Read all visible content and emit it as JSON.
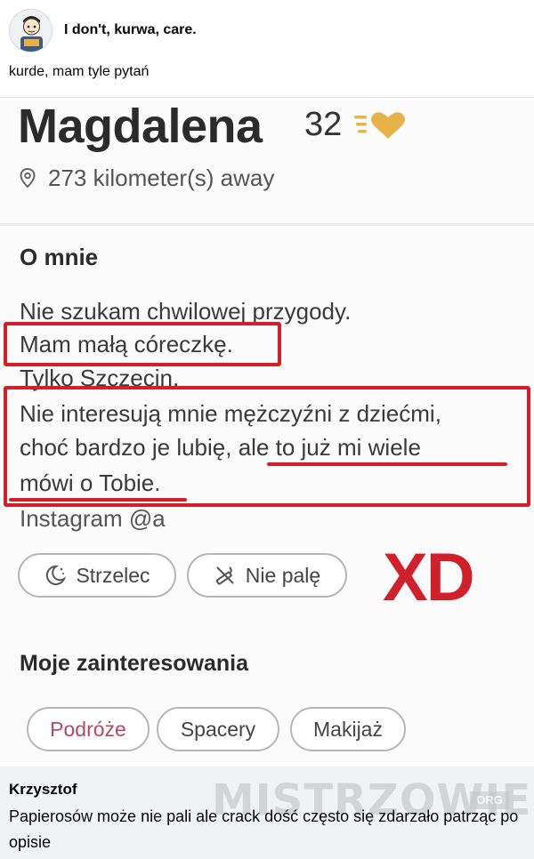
{
  "post": {
    "author": "I don't, kurwa, care.",
    "text": "kurde, mam tyle pytań"
  },
  "profile": {
    "name": "Magdalena",
    "age": "32",
    "distance": "273 kilometer(s) away",
    "about_heading": "O mnie",
    "bio": {
      "line1": "Nie szukam chwilowej przygody.",
      "line2": "Mam małą córeczkę.",
      "line3": "Tylko Szczecin.",
      "line4": "Nie interesują mnie mężczyźni z dziećmi,",
      "line5": "choć bardzo je lubię, ale to już mi wiele",
      "line6": "mówi o Tobie.",
      "line7": "Instagram @a"
    },
    "tags": {
      "sign": "Strzelec",
      "smoking": "Nie palę"
    },
    "overlay_text": "XD",
    "interests_heading": "Moje zainteresowania",
    "interests": [
      "Podróże",
      "Spacery",
      "Makijaż"
    ]
  },
  "comment": {
    "author": "Krzysztof",
    "text": "Papierosów może nie pali ale crack dość często się zdarzało patrząc po opisie"
  },
  "watermark": {
    "text": "MISTRZOWIE",
    "suffix": "ORG"
  },
  "colors": {
    "annotation_red": "#d51e27",
    "interest_pink": "#b34a63"
  },
  "icons": [
    "avatar-cartoon",
    "gold-heart-icon",
    "location-pin-icon",
    "moon-star-icon",
    "no-smoking-icon"
  ]
}
